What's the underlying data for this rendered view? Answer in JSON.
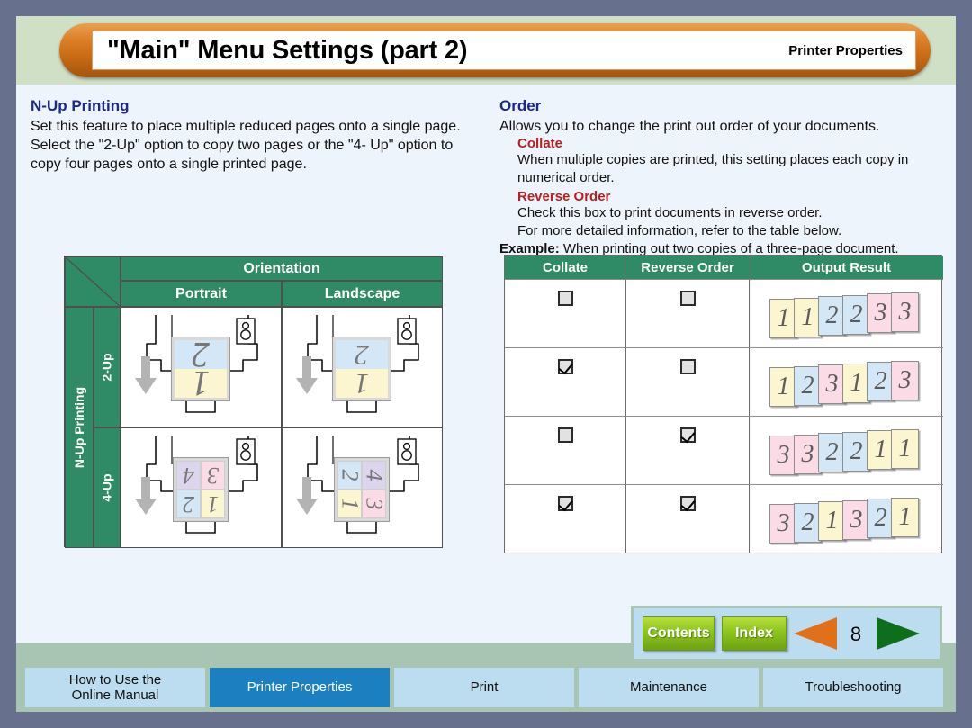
{
  "window": {
    "title": "\"Main\" Menu Settings (part 2)",
    "header_right": "Printer Properties",
    "page_number": "8",
    "colors": {
      "outer_bg": "#67708c",
      "frame": "#a8c5b4",
      "title_band": "#cfe0c6",
      "title_pill": "#df8128",
      "content_bg": "#eef4fb",
      "table_header_green": "#2f8a66",
      "heading_blue": "#1a2a8c",
      "subheading_red": "#b81f1f",
      "active_tab_blue": "#1b7fc0",
      "tab_blue": "#bcdcf0"
    }
  },
  "left": {
    "heading": "N-Up Printing",
    "body": "Set this feature to place multiple reduced pages onto a single page. Select the \"2-Up\" option to copy two pages or the \"4- Up\" option to copy four pages onto a single printed page.",
    "table": {
      "orientation_header": "Orientation",
      "col_portrait": "Portrait",
      "col_landscape": "Landscape",
      "row_group_label": "N-Up Printing",
      "row_2up": "2-Up",
      "row_4up": "4-Up",
      "cells": {
        "2up_portrait": {
          "pages": [
            "2",
            "1"
          ],
          "layout": "2-rows",
          "rotation": 180
        },
        "2up_landscape": {
          "pages": [
            "2",
            "1"
          ],
          "layout": "2-rows",
          "rotation": 180
        },
        "4up_portrait": {
          "pages": [
            "4",
            "3",
            "2",
            "1"
          ],
          "layout": "2x2",
          "rotation": 180
        },
        "4up_landscape": {
          "pages": [
            "2",
            "4",
            "1",
            "3"
          ],
          "layout": "2x2",
          "rotation": 90
        }
      }
    }
  },
  "right": {
    "heading": "Order",
    "body": "Allows you to change the print out order of your documents.",
    "collate_title": "Collate",
    "collate_body": "When multiple copies are printed, this setting places each copy in numerical order.",
    "reverse_title": "Reverse Order",
    "reverse_body_1": "Check this box to print documents in reverse order.",
    "reverse_body_2": "For more detailed information, refer to the table below.",
    "example_label": "Example:",
    "example_text": " When printing out two copies of a three-page document.",
    "table": {
      "headers": [
        "Collate",
        "Reverse Order",
        "Output Result"
      ],
      "rows": [
        {
          "collate": false,
          "reverse": false,
          "output": [
            "1",
            "1",
            "2",
            "2",
            "3",
            "3"
          ]
        },
        {
          "collate": true,
          "reverse": false,
          "output": [
            "1",
            "2",
            "3",
            "1",
            "2",
            "3"
          ]
        },
        {
          "collate": false,
          "reverse": true,
          "output": [
            "3",
            "3",
            "2",
            "2",
            "1",
            "1"
          ]
        },
        {
          "collate": true,
          "reverse": true,
          "output": [
            "3",
            "2",
            "1",
            "3",
            "2",
            "1"
          ]
        }
      ]
    }
  },
  "nav": {
    "contents_label": "Contents",
    "index_label": "Index",
    "prev_icon": "triangle-left-icon",
    "next_icon": "triangle-right-icon",
    "page_number": "8"
  },
  "tabs": [
    {
      "label": "How to Use the\nOnline Manual",
      "active": false
    },
    {
      "label": "Printer Properties",
      "active": true
    },
    {
      "label": "Print",
      "active": false
    },
    {
      "label": "Maintenance",
      "active": false
    },
    {
      "label": "Troubleshooting",
      "active": false
    }
  ]
}
